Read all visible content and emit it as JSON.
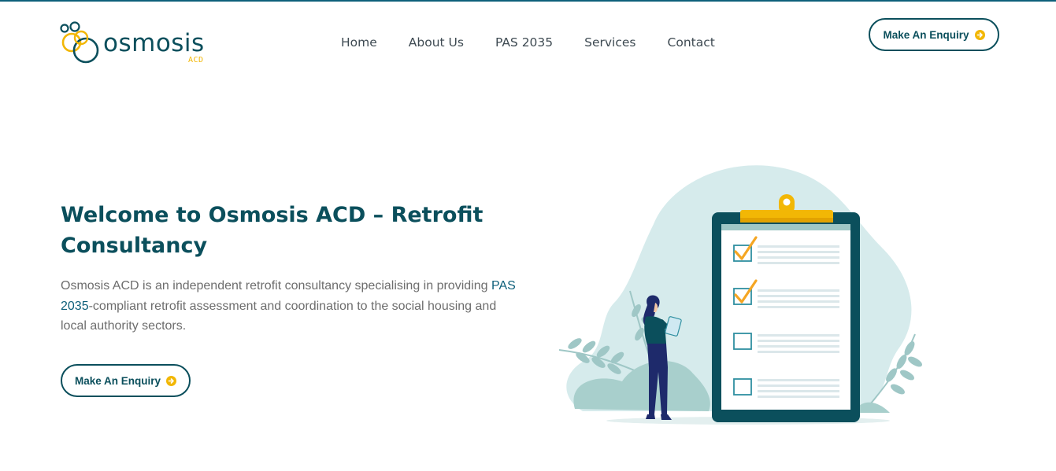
{
  "header": {
    "logo": {
      "word": "osmosis",
      "sub": "ACD"
    },
    "nav": [
      {
        "label": "Home"
      },
      {
        "label": "About Us"
      },
      {
        "label": "PAS 2035"
      },
      {
        "label": "Services"
      },
      {
        "label": "Contact"
      }
    ],
    "cta_label": "Make An Enquiry"
  },
  "hero": {
    "title": "Welcome to Osmosis ACD – Retrofit Consultancy",
    "text_before": "Osmosis ACD is an independent retrofit consultancy specialising in providing ",
    "text_link": "PAS 2035",
    "text_after": "-compliant retrofit assessment and coordination to the social housing and local authority sectors.",
    "cta_label": "Make An Enquiry"
  },
  "illustration": {
    "checklist_items": [
      {
        "checked": true
      },
      {
        "checked": true
      },
      {
        "checked": false
      },
      {
        "checked": false
      }
    ]
  },
  "colors": {
    "brand_dark": "#0b4f5c",
    "accent_yellow": "#f2b705",
    "checkmark_orange": "#f5a623",
    "blob": "#d6ebec",
    "leaf": "#9fc7c6"
  }
}
